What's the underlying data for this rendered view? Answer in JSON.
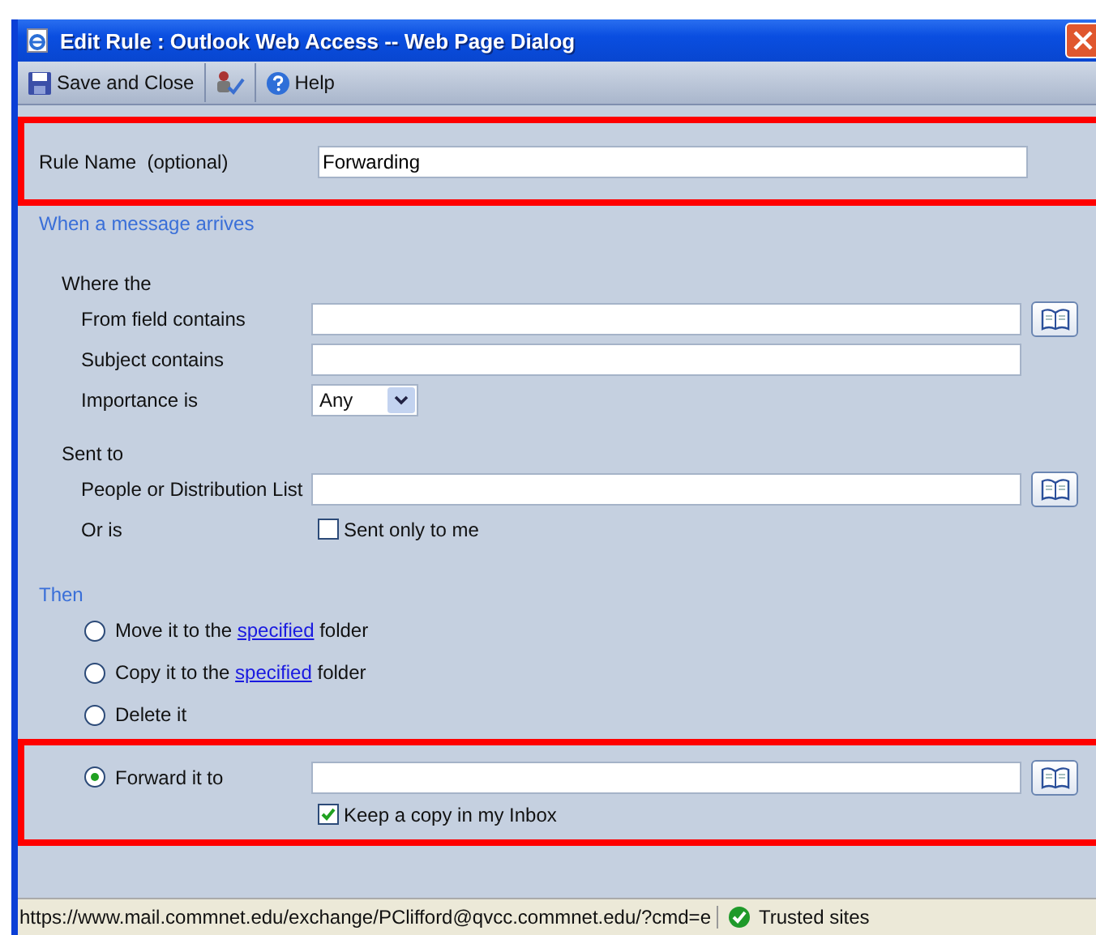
{
  "window": {
    "title": "Edit Rule : Outlook Web Access -- Web Page Dialog"
  },
  "toolbar": [
    {
      "kind": "save",
      "label": "Save and Close"
    },
    {
      "kind": "check_names"
    },
    {
      "kind": "help",
      "label": "Help"
    }
  ],
  "rule_name": {
    "label": "Rule Name  (optional)",
    "value": "Forwarding",
    "highlighted": true
  },
  "when": {
    "heading": "When a message arrives",
    "where_heading": "Where the",
    "where_rows": [
      {
        "kind": "text",
        "label": "From field contains",
        "address_book": true
      },
      {
        "kind": "text",
        "label": "Subject contains",
        "address_book": false
      },
      {
        "kind": "select",
        "label": "Importance is",
        "value": "Any"
      }
    ],
    "sent_to_heading": "Sent to",
    "sent_to_rows": [
      {
        "kind": "text",
        "label": "People or Distribution List",
        "address_book": true
      },
      {
        "kind": "checkbox",
        "label": "Or is",
        "option": "Sent only to me",
        "checked": false
      }
    ]
  },
  "then": {
    "heading": "Then",
    "actions": [
      {
        "kind": "link",
        "before": "Move it to the ",
        "link": "specified",
        "after": " folder",
        "selected": false
      },
      {
        "kind": "link",
        "before": "Copy it to the ",
        "link": "specified",
        "after": " folder",
        "selected": false
      },
      {
        "kind": "plain",
        "label": "Delete it",
        "selected": false
      }
    ],
    "forward": {
      "label": "Forward it to",
      "selected": true,
      "address_book": true,
      "highlighted": true,
      "keep_copy": {
        "label": "Keep a copy in my Inbox",
        "checked": true
      }
    }
  },
  "status_bar": {
    "url": "https://www.mail.commnet.edu/exchange/PClifford@qvcc.commnet.edu/?cmd=e",
    "zone": "Trusted sites"
  }
}
